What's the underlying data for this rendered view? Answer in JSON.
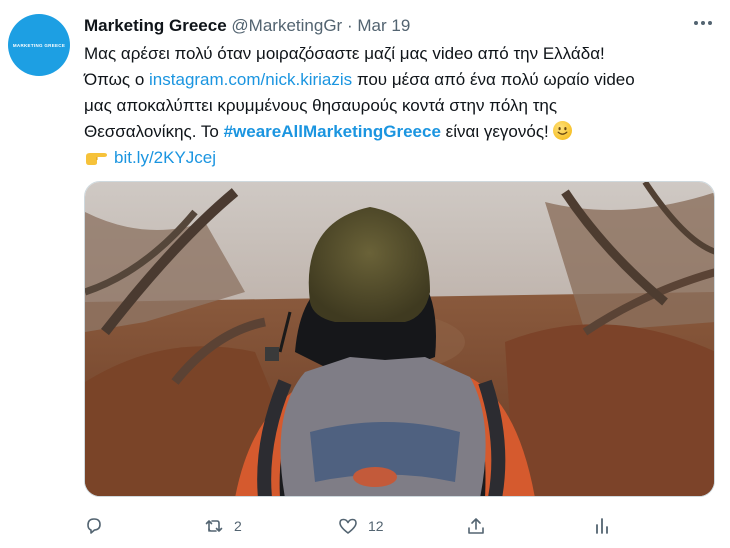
{
  "avatar": {
    "label": "MARKETING GREECE"
  },
  "tweet": {
    "display_name": "Marketing Greece",
    "handle": "@MarketingGr",
    "separator": "·",
    "date": "Mar 19",
    "line1": "Μας αρέσει πολύ όταν μοιραζόσαστε μαζί μας video από την Ελλάδα!",
    "line2_prefix": "Όπως ο ",
    "instagram_link": "instagram.com/nick.kiriazis",
    "line2_suffix": " που μέσα από ένα πολύ ωραίο video",
    "line3": "μας αποκαλύπτει κρυμμένους θησαυρούς κοντά στην πόλη της",
    "line4_prefix": "Θεσσαλονίκης. Το ",
    "hashtag": "#weareAllMarketingGreece",
    "line4_suffix": " είναι γεγονός! ",
    "short_link": "bit.ly/2KYJcej"
  },
  "actions": {
    "retweet_count": "2",
    "like_count": "12"
  },
  "icons": {
    "more": "more-dots-icon",
    "reply": "reply-icon",
    "retweet": "retweet-icon",
    "like": "heart-icon",
    "share": "share-icon",
    "analytics": "analytics-icon",
    "smile_emoji": "smiling-face-emoji",
    "pointing_emoji": "pointing-hand-emoji"
  },
  "colors": {
    "link": "#1b95e0",
    "avatar_bg": "#1d9fe3",
    "muted": "#536471",
    "text": "#0f1419"
  }
}
